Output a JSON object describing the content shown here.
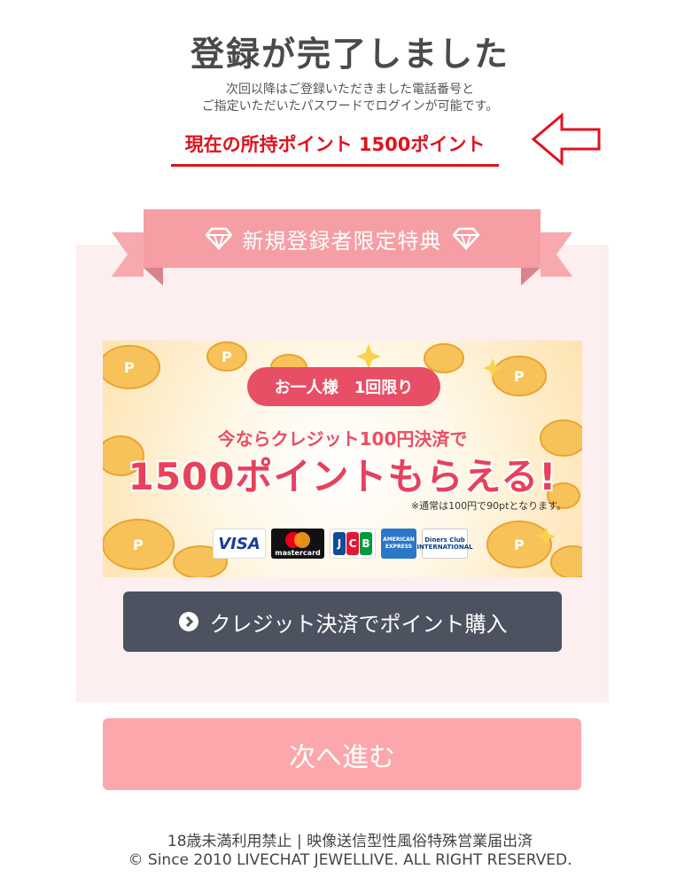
{
  "header": {
    "title": "登録が完了しました",
    "desc_line1": "次回以降はご登録いただきました電話番号と",
    "desc_line2": "ご指定いただいたパスワードでログインが可能です。",
    "points_text": "現在の所持ポイント 1500ポイント"
  },
  "ribbon": {
    "label": "新規登録者限定特典"
  },
  "banner": {
    "pill": "お一人様　1回限り",
    "line1": "今ならクレジット100円決済で",
    "line2": "1500ポイントもらえる!",
    "note": "※通常は100円で90ptとなります。",
    "cards": {
      "visa": "VISA",
      "mastercard": "mastercard",
      "jcb_j": "J",
      "jcb_c": "C",
      "jcb_b": "B",
      "amex": "AMERICAN EXPRESS",
      "diners": "Diners Club",
      "diners_sub": "INTERNATIONAL"
    }
  },
  "buttons": {
    "credit": "クレジット決済でポイント購入",
    "next": "次へ進む"
  },
  "footer": {
    "line1": "18歳未満利用禁止 | 映像送信型性風俗特殊営業届出済",
    "line2": "© Since 2010 LIVECHAT JEWELLIVE. ALL RIGHT RESERVED."
  },
  "colors": {
    "accent_red": "#e0121e",
    "ribbon_pink": "#f59ea4",
    "panel_bg": "#fdeef0",
    "credit_button": "#4d5260",
    "next_button": "#fca7ab"
  },
  "icons": [
    "arrow-left-icon",
    "diamond-icon",
    "chevron-right-circle-icon",
    "coin-icon"
  ]
}
